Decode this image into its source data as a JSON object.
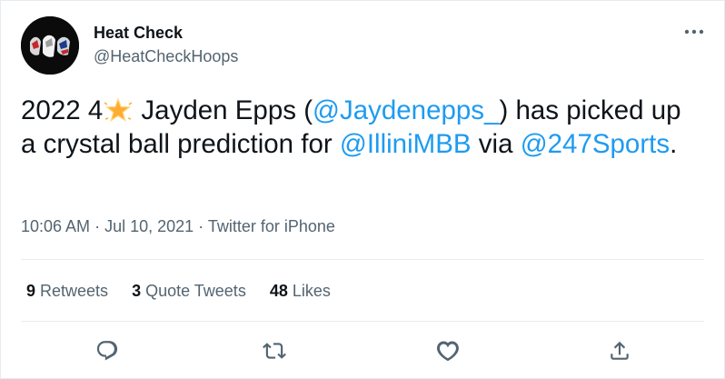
{
  "author": {
    "display_name": "Heat Check",
    "handle": "@HeatCheckHoops",
    "avatar_icon": "sneakers-avatar"
  },
  "tweet": {
    "part1": "2022 4",
    "star_icon": "star-emoji",
    "part2": " Jayden Epps (",
    "mention1": "@Jaydenepps_",
    "part3": ") has picked up a crystal ball prediction for ",
    "mention2": "@IlliniMBB",
    "part4": " via ",
    "mention3": "@247Sports",
    "part5": "."
  },
  "meta": {
    "time": "10:06 AM",
    "separator": " · ",
    "date": "Jul 10, 2021",
    "source": "Twitter for iPhone"
  },
  "stats": {
    "retweets_count": "9",
    "retweets_label": " Retweets",
    "quotes_count": "3",
    "quotes_label": " Quote Tweets",
    "likes_count": "48",
    "likes_label": " Likes"
  },
  "colors": {
    "link": "#1d9bf0",
    "secondary_text": "#536471",
    "primary_text": "#0f1419",
    "divider": "#e6ecf0"
  }
}
